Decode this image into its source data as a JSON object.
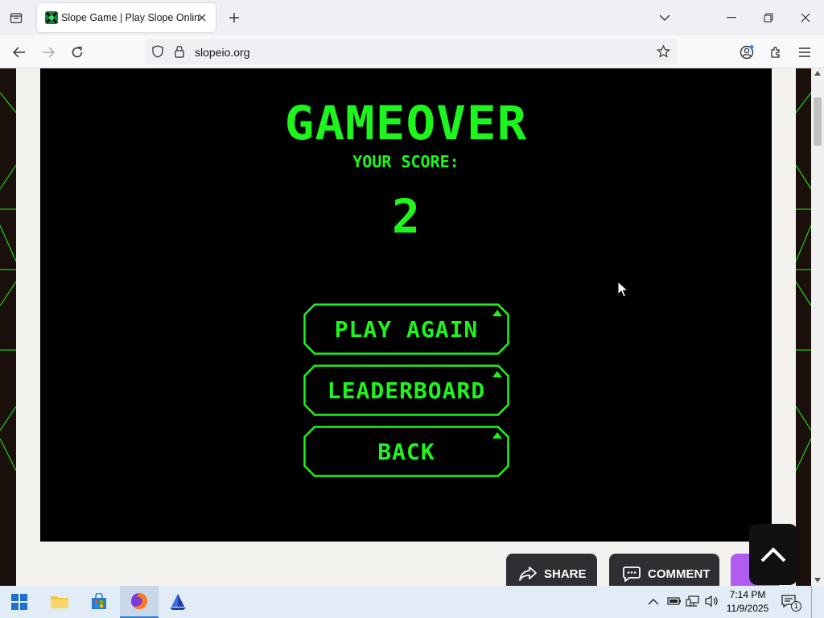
{
  "browser": {
    "tab_title": "Slope Game | Play Slope Online!",
    "url": "slopeio.org"
  },
  "game": {
    "title": "GAMEOVER",
    "score_label": "YOUR SCORE:",
    "score": "2",
    "buttons": [
      "PLAY AGAIN",
      "LEADERBOARD",
      "BACK"
    ],
    "accent_color": "#1df51d"
  },
  "page_actions": {
    "share": "SHARE",
    "comment": "COMMENT"
  },
  "taskbar": {
    "time": "7:14 PM",
    "date": "11/9/2025",
    "notification_count": "1"
  }
}
